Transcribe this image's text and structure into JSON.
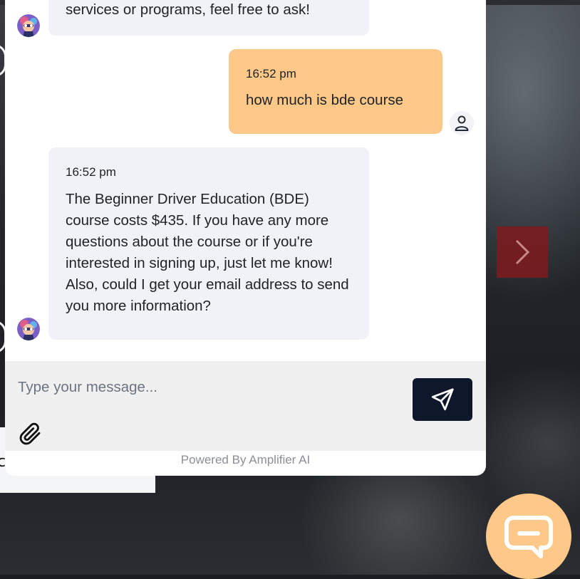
{
  "chat": {
    "messages": [
      {
        "sender": "bot",
        "time": "",
        "text": "services or programs, feel free to ask!"
      },
      {
        "sender": "user",
        "time": "16:52 pm",
        "text": "how much is bde course"
      },
      {
        "sender": "bot",
        "time": "16:52 pm",
        "text": "The Beginner Driver Education (BDE) course costs $435. If you have any more questions about the course or if you're interested in signing up, just let me know! Also, could I get your email address to send you more information?"
      }
    ],
    "input": {
      "placeholder": "Type your message...",
      "value": ""
    },
    "footer": "Powered By Amplifier AI",
    "icons": {
      "send": "send-icon",
      "attach": "paperclip-icon",
      "user_avatar": "user-icon",
      "bot_avatar": "bot-avatar",
      "launcher": "chat-bubble-icon",
      "carousel": "chevron-right-icon"
    },
    "colors": {
      "user_bubble": "#fdc888",
      "bot_bubble": "#f0f2f7",
      "send_button": "#0f172a",
      "launcher": "#fdc888",
      "carousel_button": "#781c20"
    }
  }
}
